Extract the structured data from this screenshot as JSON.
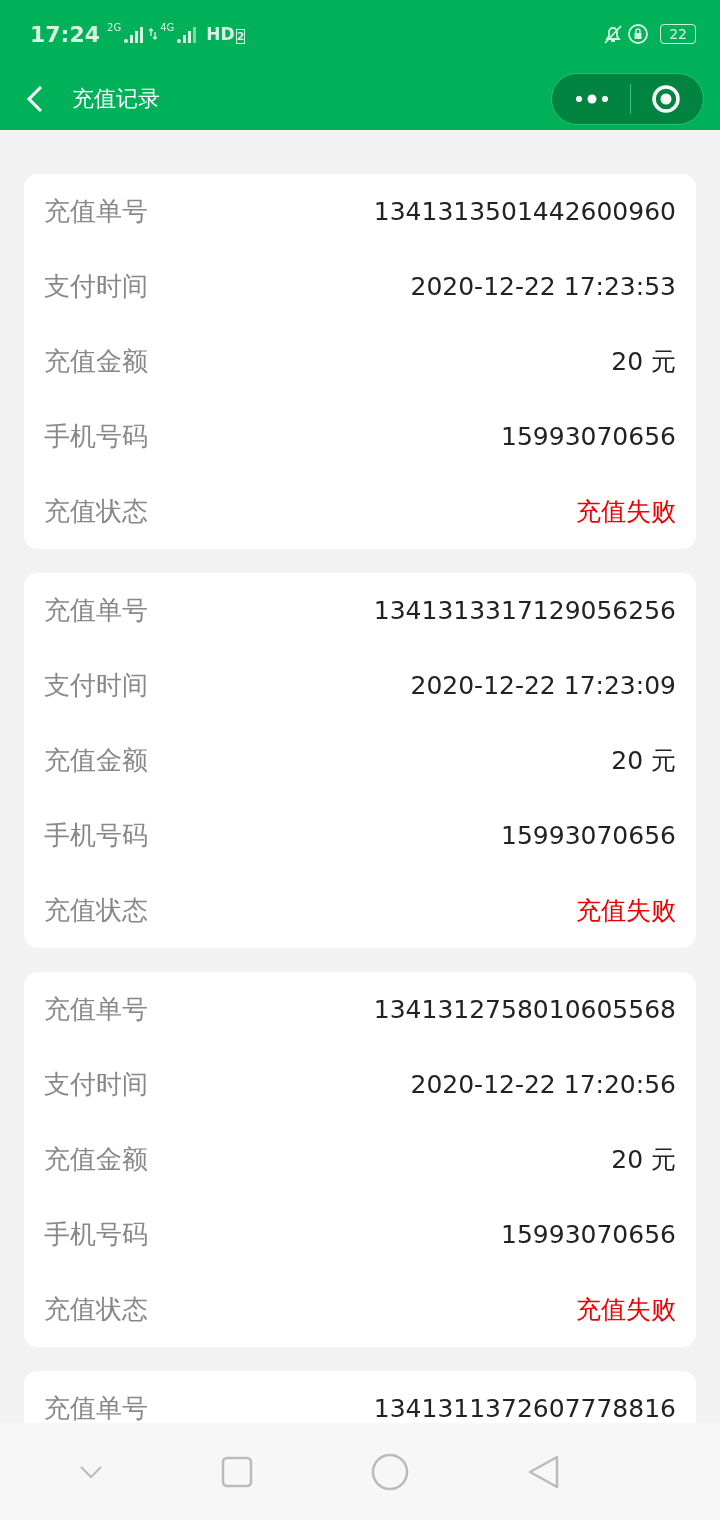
{
  "status_bar": {
    "time": "17:24",
    "sim1": "2G",
    "sim2": "4G",
    "hd": "HD",
    "hd_index": "2",
    "battery": "22"
  },
  "header": {
    "title": "充值记录"
  },
  "records": [
    {
      "rows": [
        {
          "kind": "text",
          "label": "充值单号",
          "value": "1341313501442600960"
        },
        {
          "kind": "text",
          "label": "支付时间",
          "value": "2020-12-22 17:23:53"
        },
        {
          "kind": "text",
          "label": "充值金额",
          "value": "20 元"
        },
        {
          "kind": "text",
          "label": "手机号码",
          "value": "15993070656"
        },
        {
          "kind": "status",
          "label": "充值状态",
          "value": "充值失败"
        }
      ]
    },
    {
      "rows": [
        {
          "kind": "text",
          "label": "充值单号",
          "value": "1341313317129056256"
        },
        {
          "kind": "text",
          "label": "支付时间",
          "value": "2020-12-22 17:23:09"
        },
        {
          "kind": "text",
          "label": "充值金额",
          "value": "20 元"
        },
        {
          "kind": "text",
          "label": "手机号码",
          "value": "15993070656"
        },
        {
          "kind": "status",
          "label": "充值状态",
          "value": "充值失败"
        }
      ]
    },
    {
      "rows": [
        {
          "kind": "text",
          "label": "充值单号",
          "value": "1341312758010605568"
        },
        {
          "kind": "text",
          "label": "支付时间",
          "value": "2020-12-22 17:20:56"
        },
        {
          "kind": "text",
          "label": "充值金额",
          "value": "20 元"
        },
        {
          "kind": "text",
          "label": "手机号码",
          "value": "15993070656"
        },
        {
          "kind": "status",
          "label": "充值状态",
          "value": "充值失败"
        }
      ]
    },
    {
      "rows": [
        {
          "kind": "text",
          "label": "充值单号",
          "value": "1341311372607778816"
        }
      ]
    }
  ]
}
